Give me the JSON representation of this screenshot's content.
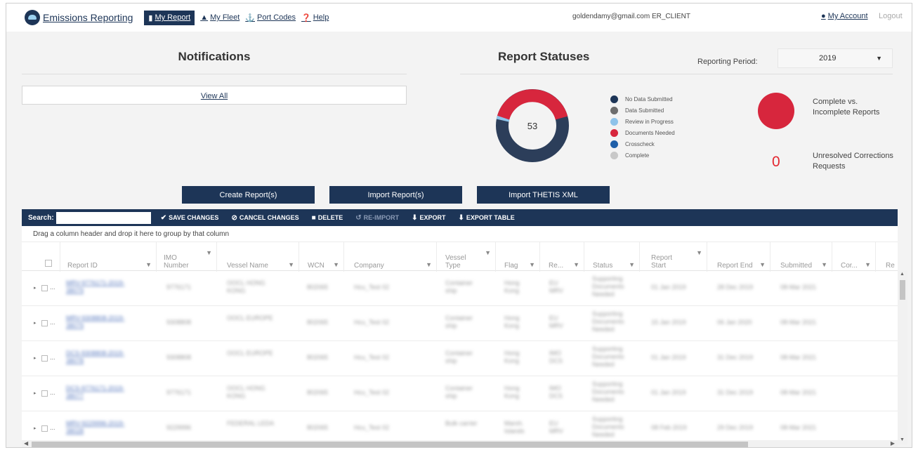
{
  "nav": {
    "brand": "Emissions Reporting",
    "items": [
      {
        "label": "My Report",
        "icon": "file-icon",
        "active": true
      },
      {
        "label": "My Fleet",
        "icon": "ship-icon",
        "active": false
      },
      {
        "label": "Port Codes",
        "icon": "anchor-icon",
        "active": false
      },
      {
        "label": "Help",
        "icon": "help-icon",
        "active": false
      }
    ],
    "user": "goldendamy@gmail.com ER_CLIENT",
    "my_account": "My Account",
    "logout": "Logout"
  },
  "notifications": {
    "title": "Notifications",
    "view_all": "View All"
  },
  "statuses": {
    "title": "Report Statuses",
    "period_label": "Reporting Period:",
    "period_value": "2019",
    "total": "53",
    "legend": [
      {
        "label": "No Data Submitted",
        "color": "#1d3557"
      },
      {
        "label": "Data Submitted",
        "color": "#6d6d6d"
      },
      {
        "label": "Review in Progress",
        "color": "#8ec3ea"
      },
      {
        "label": "Documents Needed",
        "color": "#d7263d"
      },
      {
        "label": "Crosscheck",
        "color": "#1f5fa8"
      },
      {
        "label": "Complete",
        "color": "#c8c8c8"
      }
    ],
    "complete_label": "Complete vs. Incomplete Reports",
    "corrections_count": "0",
    "corrections_label": "Unresolved Corrections Requests"
  },
  "actions": {
    "create": "Create Report(s)",
    "import": "Import Report(s)",
    "thetis": "Import THETIS XML"
  },
  "toolbar": {
    "search_label": "Search:",
    "save": "SAVE CHANGES",
    "cancel": "CANCEL CHANGES",
    "delete": "DELETE",
    "reimport": "RE-IMPORT",
    "export": "EXPORT",
    "export_table": "EXPORT TABLE"
  },
  "group_hint": "Drag a column header and drop it here to group by that column",
  "columns": {
    "report_id": "Report ID",
    "imo_1": "IMO",
    "imo_2": "Number",
    "vessel_name": "Vessel Name",
    "wcn": "WCN",
    "company": "Company",
    "vessel_type_1": "Vessel",
    "vessel_type_2": "Type",
    "flag": "Flag",
    "re": "Re...",
    "status": "Status",
    "report_start_1": "Report",
    "report_start_2": "Start",
    "report_end": "Report End",
    "submitted": "Submitted",
    "cor": "Cor...",
    "re2": "Re"
  },
  "rows": [
    {
      "id1": "MRV-9776171-2019-",
      "id2": "38079",
      "imo": "9776171",
      "vessel1": "OOCL HONG",
      "vessel2": "KONG",
      "wcn": "802065",
      "company": "Hcu_Test 02",
      "type1": "Container",
      "type2": "ship",
      "flag1": "Hong",
      "flag2": "Kong",
      "re1": "EU",
      "re2": "MRV",
      "status1": "Supporting",
      "status2": "Documents",
      "status3": "Needed",
      "start": "01 Jan 2019",
      "end": "28 Dec 2019",
      "submitted": "08-Mar 2021"
    },
    {
      "id1": "MRV-9308808-2019-",
      "id2": "38079",
      "imo": "9308808",
      "vessel1": "OOCL EUROPE",
      "vessel2": "",
      "wcn": "802065",
      "company": "Hcu_Test 02",
      "type1": "Container",
      "type2": "ship",
      "flag1": "Hong",
      "flag2": "Kong",
      "re1": "EU",
      "re2": "MRV",
      "status1": "Supporting",
      "status2": "Documents",
      "status3": "Needed",
      "start": "15 Jan 2019",
      "end": "06 Jan 2020",
      "submitted": "08-Mar 2021"
    },
    {
      "id1": "DCS-9308808-2019-",
      "id2": "38078",
      "imo": "9308808",
      "vessel1": "OOCL EUROPE",
      "vessel2": "",
      "wcn": "802065",
      "company": "Hcu_Test 02",
      "type1": "Container",
      "type2": "ship",
      "flag1": "Hong",
      "flag2": "Kong",
      "re1": "IMO",
      "re2": "DCS",
      "status1": "Supporting",
      "status2": "Documents",
      "status3": "Needed",
      "start": "01 Jan 2019",
      "end": "31 Dec 2019",
      "submitted": "08-Mar 2021"
    },
    {
      "id1": "DCS-9776171-2019-",
      "id2": "38077",
      "imo": "9776171",
      "vessel1": "OOCL HONG",
      "vessel2": "KONG",
      "wcn": "802065",
      "company": "Hcu_Test 02",
      "type1": "Container",
      "type2": "ship",
      "flag1": "Hong",
      "flag2": "Kong",
      "re1": "IMO",
      "re2": "DCS",
      "status1": "Supporting",
      "status2": "Documents",
      "status3": "Needed",
      "start": "01 Jan 2019",
      "end": "31 Dec 2019",
      "submitted": "08-Mar 2021"
    },
    {
      "id1": "MRV-9229996-2019-",
      "id2": "38028",
      "imo": "9229996",
      "vessel1": "FEDERAL LEDA",
      "vessel2": "",
      "wcn": "802065",
      "company": "Hcu_Test 02",
      "type1": "Bulk carrier",
      "type2": "",
      "flag1": "Marsh.",
      "flag2": "Islands",
      "re1": "EU",
      "re2": "MRV",
      "status1": "Supporting",
      "status2": "Documents",
      "status3": "Needed",
      "start": "08 Feb 2019",
      "end": "29 Dec 2019",
      "submitted": "08-Mar 2021"
    }
  ]
}
